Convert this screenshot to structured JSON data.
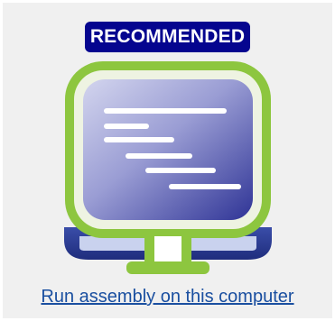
{
  "badge": {
    "label": "RECOMMENDED"
  },
  "icon": {
    "name": "computer-monitor-icon"
  },
  "link": {
    "label": "Run assembly on this computer"
  },
  "colors": {
    "card_background": "#f0f0f0",
    "badge_background": "#05058f",
    "badge_text": "#ffffff",
    "monitor_frame": "#8dc63f",
    "monitor_base": "#27388f",
    "screen_light": "#c9cbe9",
    "screen_dark": "#3a3f9e",
    "link_text": "#1a4fa0"
  }
}
